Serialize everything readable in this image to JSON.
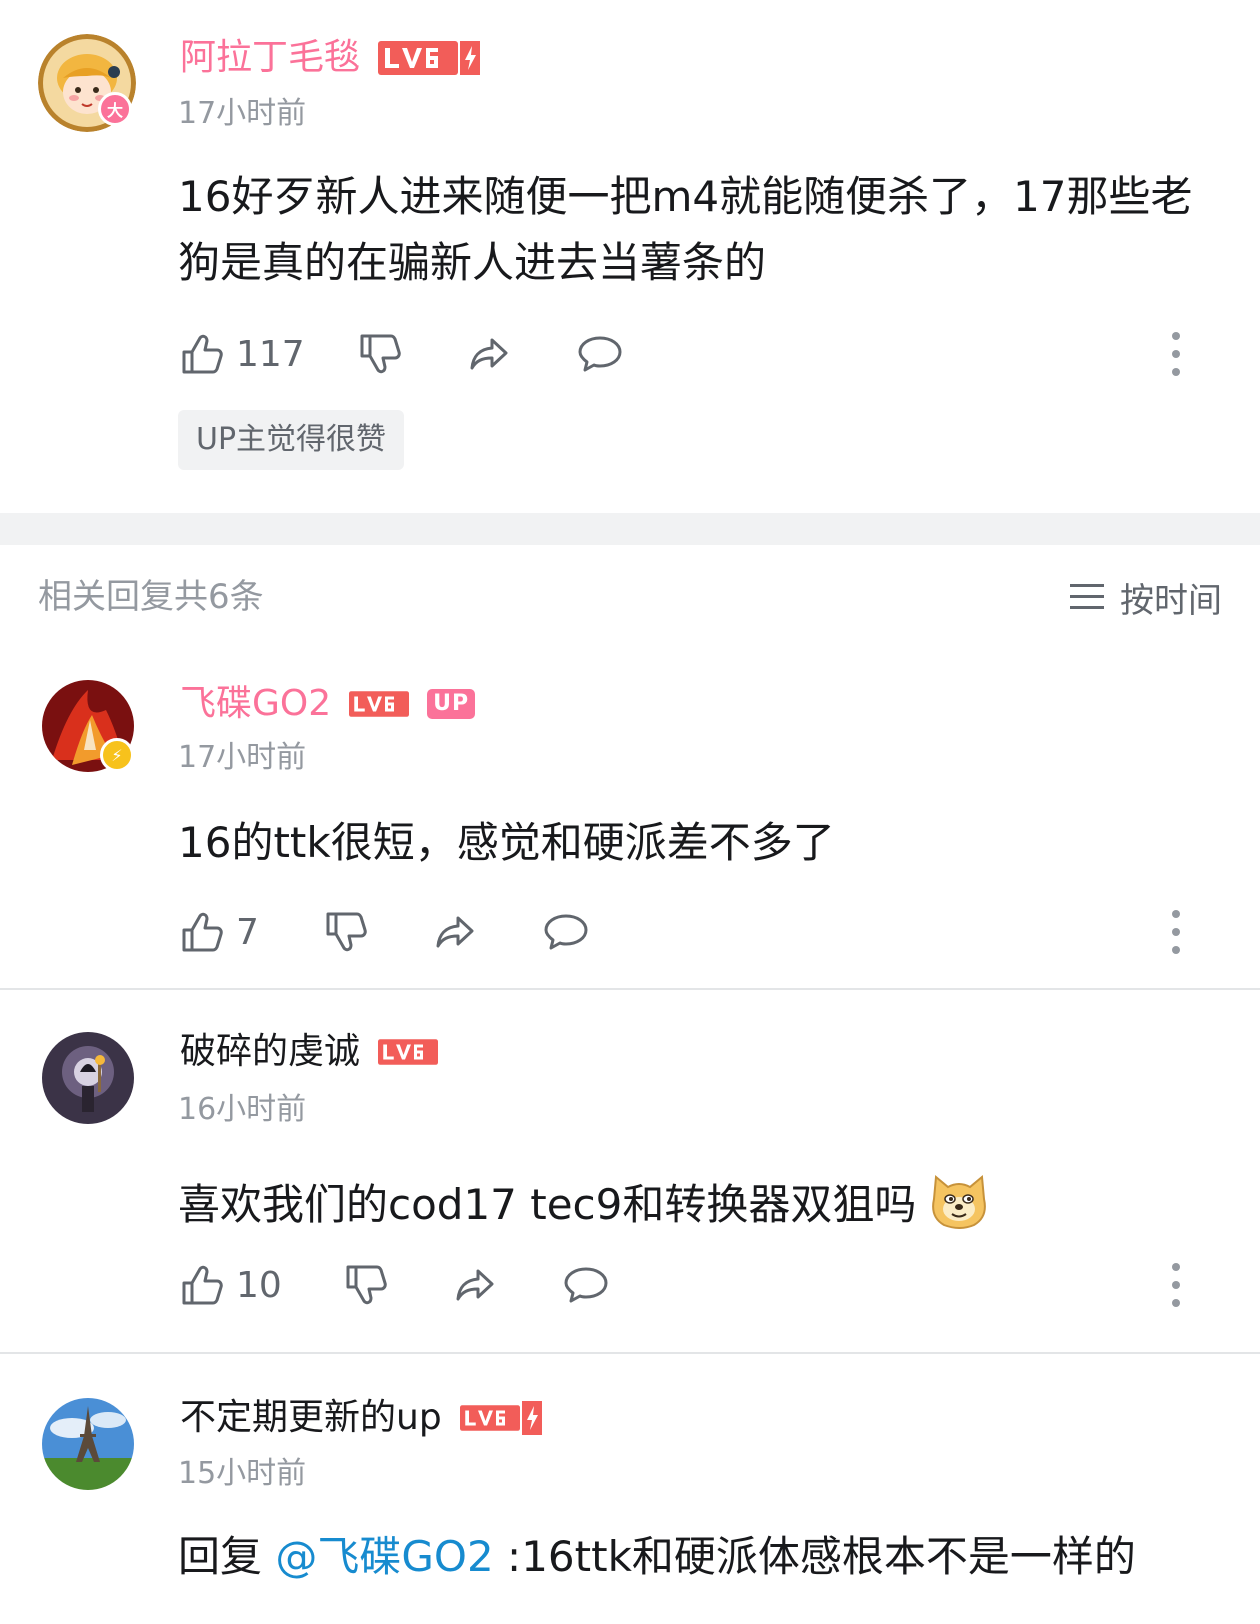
{
  "main_comment": {
    "username": "阿拉丁毛毯",
    "level": "LV6",
    "time": "17小时前",
    "text": "16好歹新人进来随便一把m4就能随便杀了，17那些老狗是真的在骗新人进去当薯条的",
    "likes": "117",
    "up_liked_label": "UP主觉得很赞",
    "avatar_badge": "大"
  },
  "replies_header": {
    "count_label": "相关回复共6条",
    "sort_label": "按时间"
  },
  "replies": [
    {
      "username": "飞碟GO2",
      "level": "LV6",
      "up_tag": "UP",
      "time": "17小时前",
      "text": "16的ttk很短，感觉和硬派差不多了",
      "likes": "7"
    },
    {
      "username": "破碎的虔诚",
      "level": "LV6",
      "time": "16小时前",
      "text": "喜欢我们的cod17 tec9和转换器双狙吗",
      "likes": "10"
    },
    {
      "username": "不定期更新的up",
      "level": "LV6",
      "time": "15小时前",
      "reply_prefix": "回复 ",
      "mention": "@飞碟GO2",
      "text": " :16ttk和硬派体感根本不是一样的"
    }
  ],
  "colors": {
    "vip_pink": "#fb7299",
    "level_red": "#f25d59",
    "mention_blue": "#178bcf",
    "gray_text": "#9499a0"
  },
  "icons": [
    "like-icon",
    "dislike-icon",
    "share-icon",
    "comment-icon",
    "more-icon",
    "sort-icon",
    "doge-emoji"
  ]
}
